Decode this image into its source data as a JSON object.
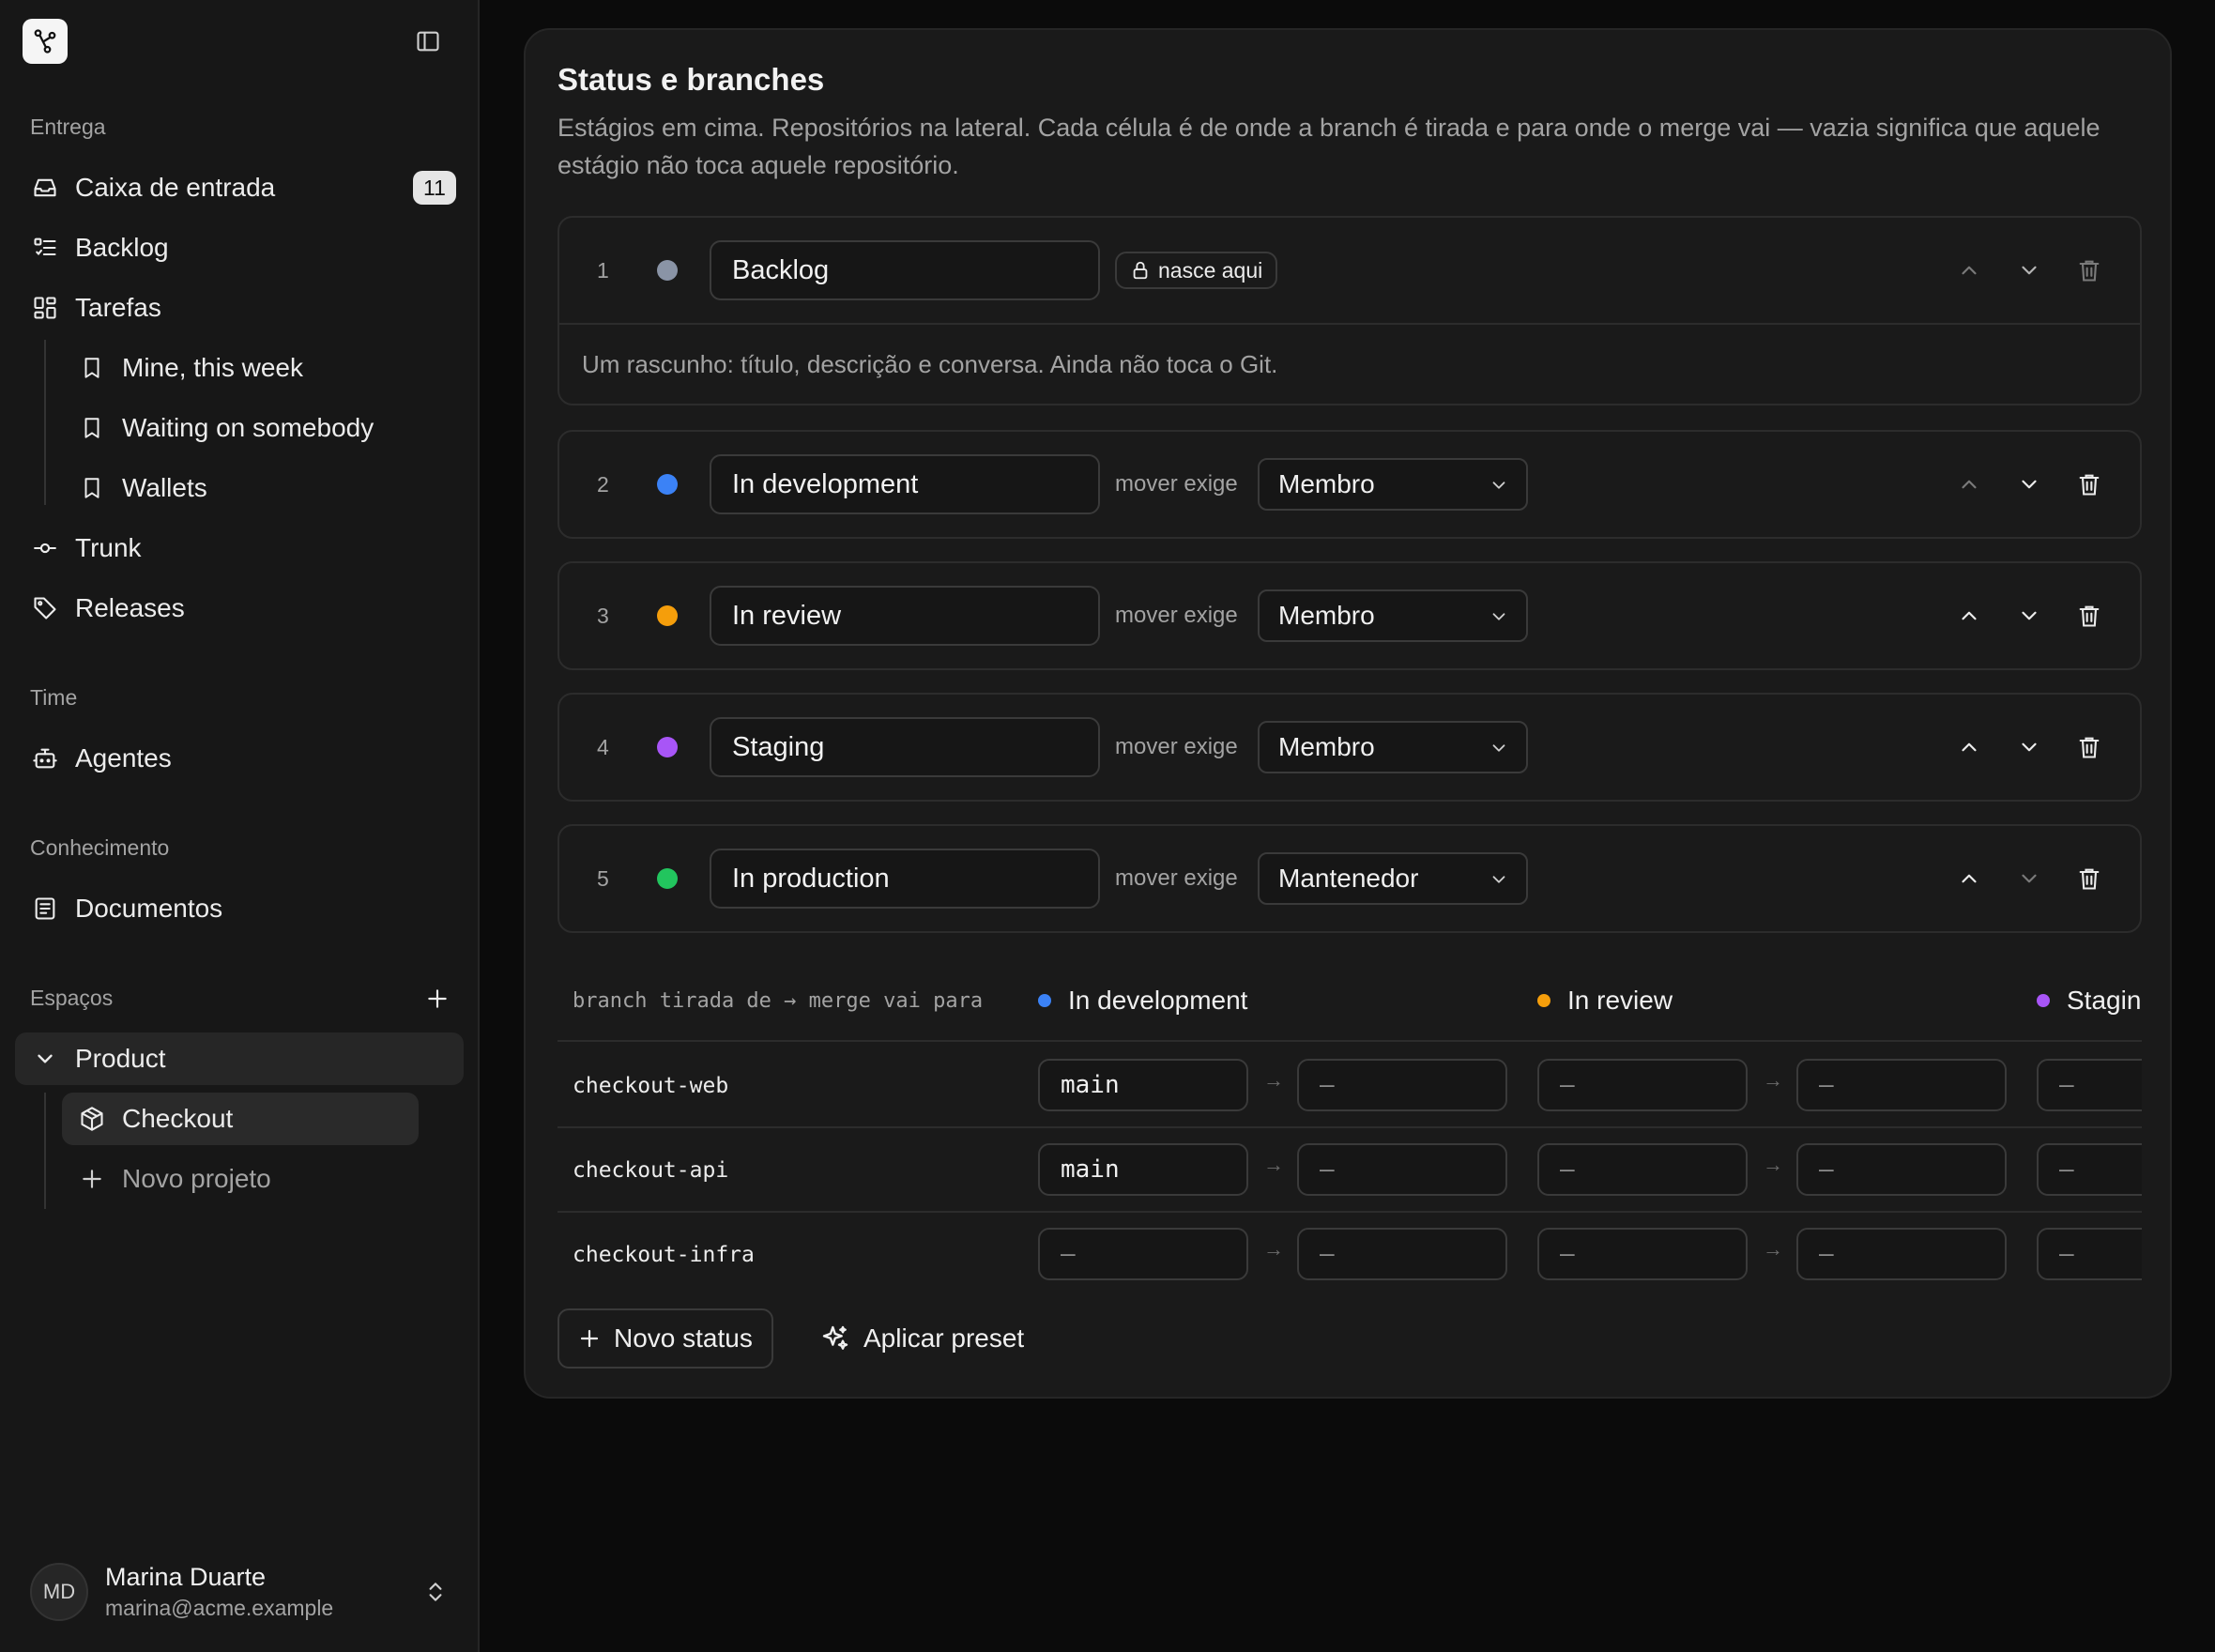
{
  "sidebar": {
    "sections": {
      "entrega": "Entrega",
      "time": "Time",
      "conhecimento": "Conhecimento",
      "espacos": "Espaços"
    },
    "items": {
      "inbox": {
        "label": "Caixa de entrada",
        "count": "11"
      },
      "backlog": {
        "label": "Backlog"
      },
      "tarefas": {
        "label": "Tarefas"
      },
      "mine": {
        "label": "Mine, this week"
      },
      "waiting": {
        "label": "Waiting on somebody"
      },
      "wallets": {
        "label": "Wallets"
      },
      "trunk": {
        "label": "Trunk"
      },
      "releases": {
        "label": "Releases"
      },
      "agentes": {
        "label": "Agentes"
      },
      "documentos": {
        "label": "Documentos"
      },
      "product": {
        "label": "Product"
      },
      "checkout": {
        "label": "Checkout"
      },
      "novo_projeto": {
        "label": "Novo projeto"
      }
    },
    "user": {
      "initials": "MD",
      "name": "Marina Duarte",
      "email": "marina@acme.example"
    }
  },
  "main": {
    "title": "Status e branches",
    "description": "Estágios em cima. Repositórios na lateral. Cada célula é de onde a branch é tirada e para onde o merge vai — vazia significa que aquele estágio não toca aquele repositório.",
    "stages": [
      {
        "num": "1",
        "name": "Backlog",
        "color": "#8a94a6",
        "lock_label": "nasce aqui",
        "description": "Um rascunho: título, descrição e conversa. Ainda não toca o Git."
      },
      {
        "num": "2",
        "name": "In development",
        "color": "#3b82f6",
        "mover_label": "mover exige",
        "role": "Membro"
      },
      {
        "num": "3",
        "name": "In review",
        "color": "#f59e0b",
        "mover_label": "mover exige",
        "role": "Membro"
      },
      {
        "num": "4",
        "name": "Staging",
        "color": "#a855f7",
        "mover_label": "mover exige",
        "role": "Membro"
      },
      {
        "num": "5",
        "name": "In production",
        "color": "#22c55e",
        "mover_label": "mover exige",
        "role": "Mantenedor"
      }
    ],
    "matrix": {
      "header_label": "branch tirada de → merge vai para",
      "columns": [
        {
          "name": "In development",
          "color": "#3b82f6"
        },
        {
          "name": "In review",
          "color": "#f59e0b"
        },
        {
          "name": "Staging",
          "color": "#a855f7"
        }
      ],
      "arrow": "→",
      "empty": "—",
      "rows": [
        {
          "repo": "checkout-web",
          "cells": [
            "main",
            "—",
            "—",
            "—",
            "—"
          ]
        },
        {
          "repo": "checkout-api",
          "cells": [
            "main",
            "—",
            "—",
            "—",
            "—"
          ]
        },
        {
          "repo": "checkout-infra",
          "cells": [
            "—",
            "—",
            "—",
            "—",
            "—"
          ]
        }
      ]
    },
    "actions": {
      "new_status": "Novo status",
      "apply_preset": "Aplicar preset"
    }
  }
}
